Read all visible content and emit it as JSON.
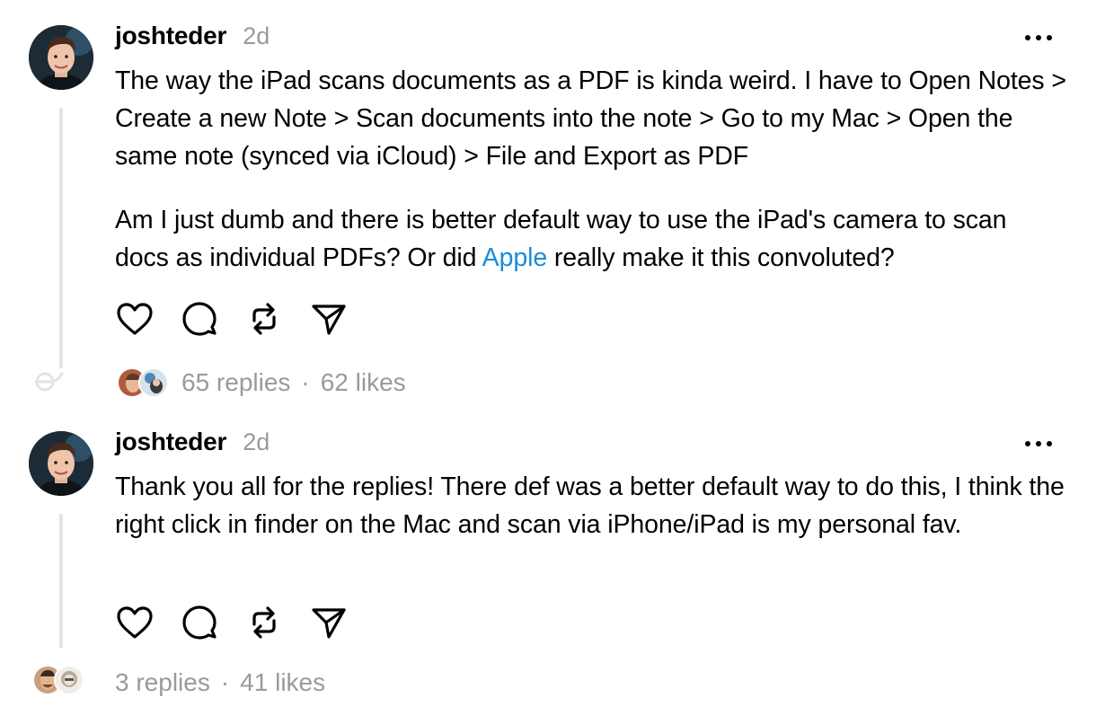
{
  "posts": [
    {
      "username": "joshteder",
      "time": "2d",
      "paragraphs": [
        {
          "before": "The way the iPad scans documents as a PDF is kinda weird. I have to Open Notes > Create a new Note > Scan documents into the note > Go to my Mac > Open the same note (synced via iCloud) > File and Export as PDF",
          "link": "",
          "after": ""
        },
        {
          "before": "Am I just dumb and there is better default way to use the iPad's camera to scan docs as individual PDFs? Or did ",
          "link": "Apple",
          "after": " really make it this convoluted?"
        }
      ],
      "replies": "65 replies",
      "separator": "·",
      "likes": "62 likes"
    },
    {
      "username": "joshteder",
      "time": "2d",
      "paragraphs": [
        {
          "before": "Thank you all for the replies! There def was a better default way to do this, I think the right click in finder on the Mac and scan via iPhone/iPad is my personal fav.",
          "link": "",
          "after": ""
        }
      ],
      "replies": "3 replies",
      "separator": "·",
      "likes": "41 likes"
    }
  ],
  "icons": {
    "more": "more-horizontal-icon",
    "like": "heart-icon",
    "reply": "comment-bubble-icon",
    "repost": "repost-icon",
    "share": "send-icon",
    "thread": "thread-loop-icon"
  },
  "colors": {
    "link": "#1a8cd8",
    "muted": "#9a9a9a",
    "thread_line": "#e3e3e3"
  }
}
